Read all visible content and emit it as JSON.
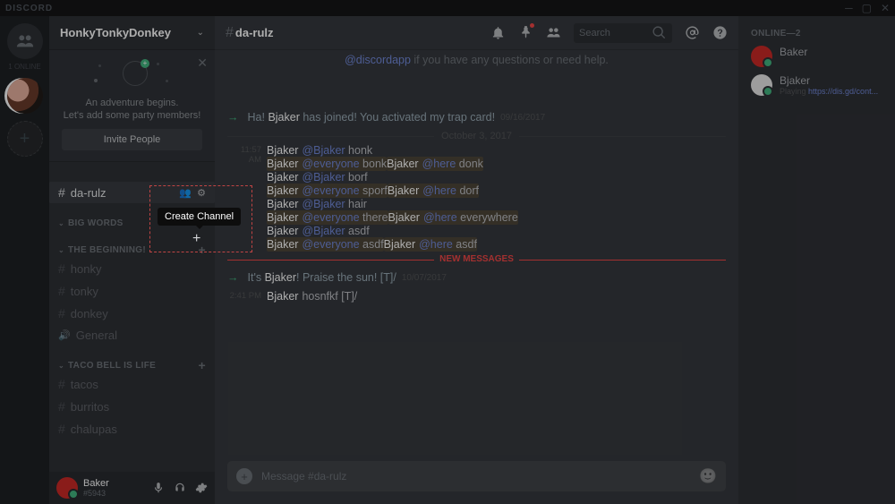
{
  "titlebar": {
    "brand": "DISCORD"
  },
  "guilds": {
    "online_label": "1 ONLINE"
  },
  "server": {
    "name": "HonkyTonkyDonkey"
  },
  "invite": {
    "line1": "An adventure begins.",
    "line2": "Let's add some party members!",
    "button": "Invite People"
  },
  "tooltip": {
    "create_channel": "Create Channel"
  },
  "channels": {
    "da_rulz": "da-rulz",
    "cat1": {
      "label": "BIG WORDS"
    },
    "cat2": {
      "label": "THE BEGINNING!",
      "items": [
        "honky",
        "tonky",
        "donkey",
        "General"
      ]
    },
    "cat3": {
      "label": "TACO BELL IS LIFE",
      "items": [
        "tacos",
        "burritos",
        "chalupas"
      ]
    }
  },
  "self": {
    "username": "Baker",
    "discriminator": "#5943"
  },
  "header": {
    "channel": "da-rulz",
    "search_placeholder": "Search"
  },
  "welcome": {
    "pre": "@discordapp",
    "post": " if you have any questions or need help."
  },
  "date_div": "October 3, 2017",
  "sys1": {
    "pre": "Ha! ",
    "user": "Bjaker",
    "post": " has joined! You activated my trap card!",
    "ts": "09/16/2017"
  },
  "group1": {
    "time": "11:57 AM",
    "author": "Bjaker",
    "lines": [
      {
        "mention": "@Bjaker",
        "text": "honk",
        "hl": false
      },
      {
        "mention": "@everyone",
        "text": "bonk",
        "hl": true
      },
      {
        "mention": "@here",
        "text": "donk",
        "hl": true
      },
      {
        "mention": "@Bjaker",
        "text": "borf",
        "hl": false
      },
      {
        "mention": "@everyone",
        "text": "sporf",
        "hl": true
      },
      {
        "mention": "@here",
        "text": "dorf",
        "hl": true
      },
      {
        "mention": "@Bjaker",
        "text": "hair",
        "hl": false
      },
      {
        "mention": "@everyone",
        "text": "there",
        "hl": true
      },
      {
        "mention": "@here",
        "text": "everywhere",
        "hl": true
      },
      {
        "mention": "@Bjaker",
        "text": "asdf",
        "hl": false
      },
      {
        "mention": "@everyone",
        "text": "asdf",
        "hl": true
      },
      {
        "mention": "@here",
        "text": "asdf",
        "hl": true
      }
    ]
  },
  "new_div": "NEW MESSAGES",
  "sys2": {
    "pre": "It's ",
    "user": "Bjaker",
    "post": "! Praise the sun! [T]/",
    "ts": "10/07/2017"
  },
  "group2": {
    "time": "2:41 PM",
    "author": "Bjaker",
    "line": "hosnfkf [T]/"
  },
  "composer": {
    "placeholder": "Message #da-rulz"
  },
  "members": {
    "header": "ONLINE—2",
    "list": [
      {
        "name": "Baker",
        "status": null,
        "link": null
      },
      {
        "name": "Bjaker",
        "status": "Playing ",
        "link": "https://dis.gd/cont..."
      }
    ]
  }
}
